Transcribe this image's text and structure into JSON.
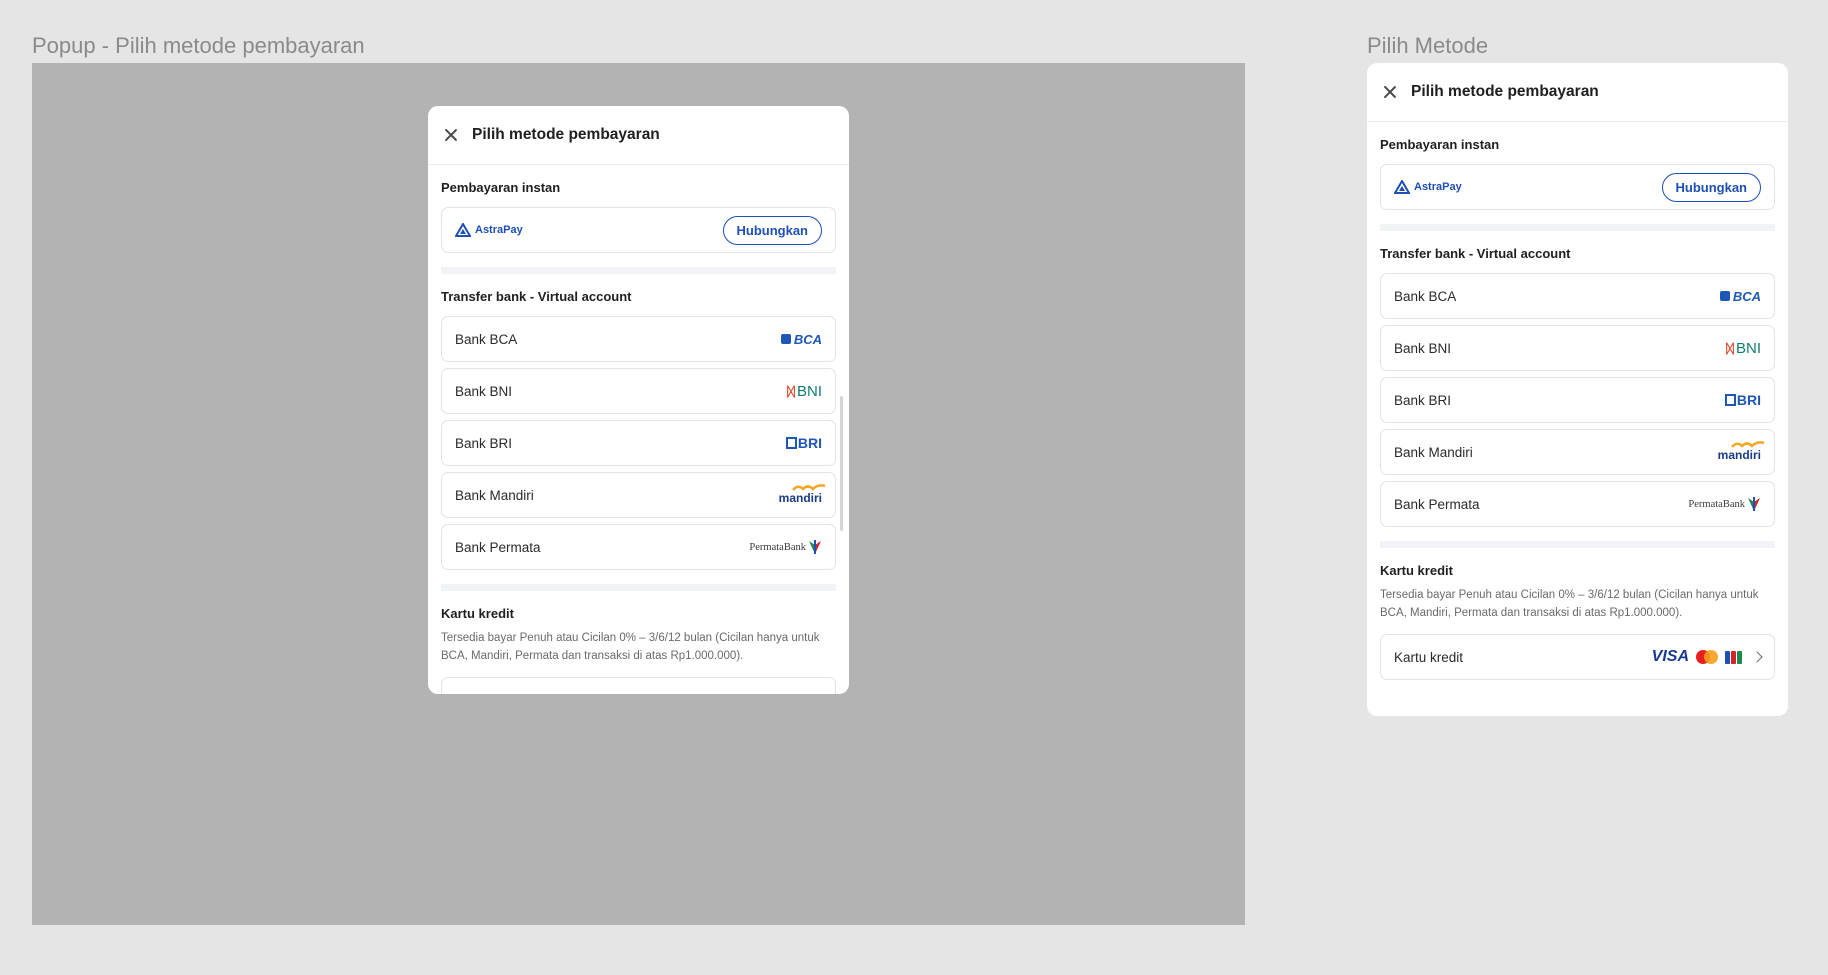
{
  "frames": {
    "left_label": "Popup - Pilih metode pembayaran",
    "right_label": "Pilih Metode"
  },
  "sheet": {
    "title": "Pilih metode pembayaran",
    "instant": {
      "title": "Pembayaran instan",
      "provider": "AstraPay",
      "button": "Hubungkan"
    },
    "va": {
      "title": "Transfer bank - Virtual account",
      "banks": [
        {
          "label": "Bank BCA",
          "logo": "BCA"
        },
        {
          "label": "Bank BNI",
          "logo": "BNI"
        },
        {
          "label": "Bank BRI",
          "logo": "BRI"
        },
        {
          "label": "Bank Mandiri",
          "logo": "mandiri"
        },
        {
          "label": "Bank Permata",
          "logo": "PermataBank"
        }
      ]
    },
    "credit": {
      "title": "Kartu kredit",
      "description": "Tersedia bayar Penuh atau Cicilan 0% – 3/6/12 bulan (Cicilan hanya untuk BCA, Mandiri, Permata dan transaksi di atas Rp1.000.000).",
      "card_label": "Kartu kredit",
      "brands": [
        "VISA",
        "mastercard",
        "JCB"
      ]
    }
  },
  "colors": {
    "accent": "#1d4fb4",
    "overlay": "#b3b3b3",
    "canvas": "#e5e5e5"
  }
}
